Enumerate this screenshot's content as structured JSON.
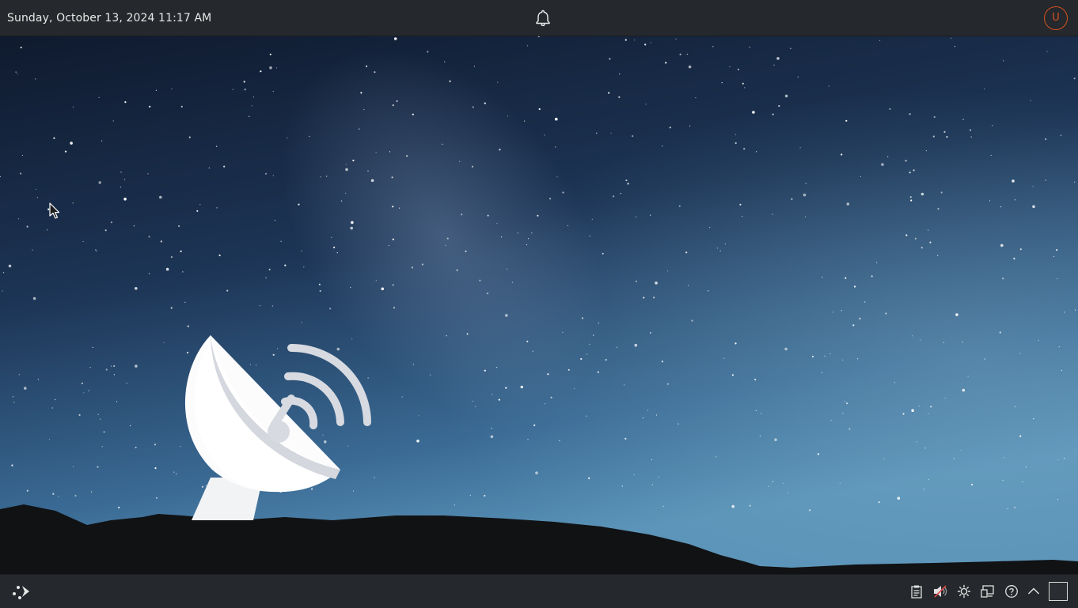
{
  "topbar": {
    "datetime": "Sunday, October 13, 2024 11:17 AM",
    "notifications_icon": "bell-icon",
    "user_avatar_letter": "U"
  },
  "desktop": {
    "wallpaper": "starry-night-sky",
    "logo_icon": "satellite-dish-icon"
  },
  "taskbar": {
    "launcher_icon": "app-launcher-icon",
    "tray_icons": [
      "clipboard-icon",
      "volume-muted-icon",
      "brightness-icon",
      "display-icon",
      "help-icon",
      "expand-tray-icon"
    ],
    "show_desktop_icon": "show-desktop-icon"
  },
  "colors": {
    "panel_bg": "#25282c",
    "accent": "#d4521f",
    "text": "#e8e8e8"
  }
}
